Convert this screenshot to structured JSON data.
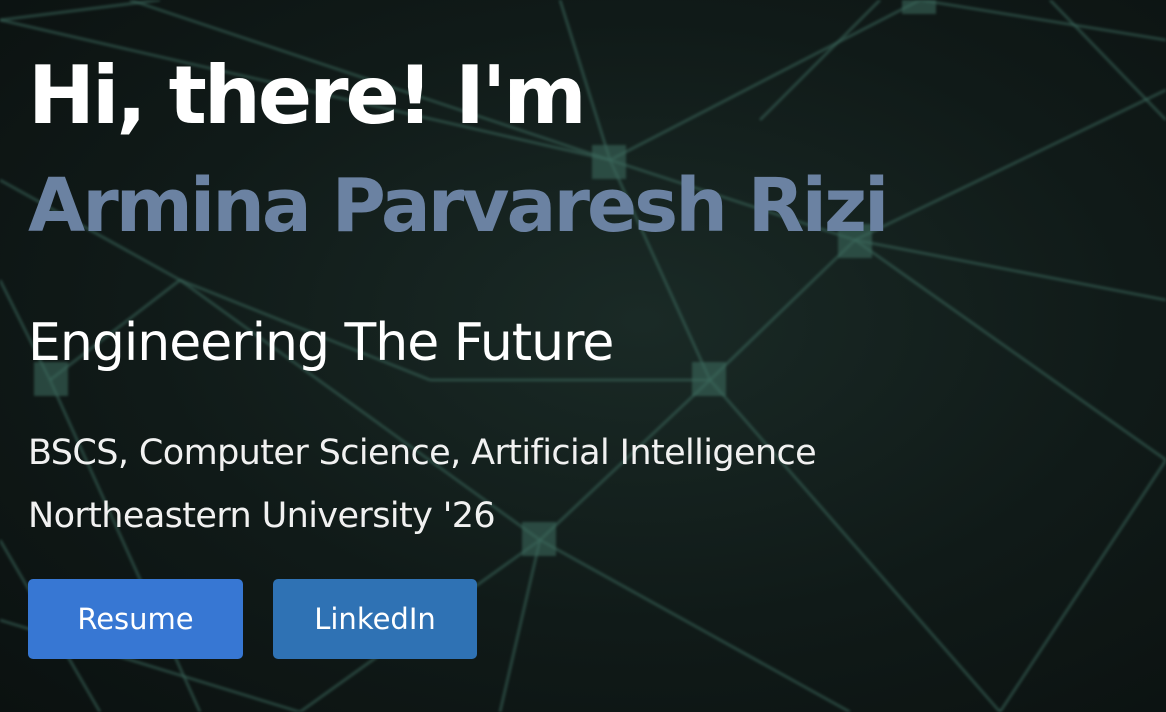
{
  "hero": {
    "greeting": "Hi, there! I'm",
    "name": "Armina Parvaresh Rizi",
    "tagline": "Engineering The Future",
    "degree": "BSCS, Computer Science, Artificial Intelligence",
    "school": "Northeastern University '26"
  },
  "buttons": {
    "resume_label": "Resume",
    "linkedin_label": "LinkedIn"
  },
  "colors": {
    "background": "#101a18",
    "name_accent": "#6b82a2",
    "resume_button": "#3777d3",
    "linkedin_button": "#2f72b4",
    "network_lines": "#3f6f62"
  },
  "background": {
    "graphic": "network-graph-icon"
  }
}
